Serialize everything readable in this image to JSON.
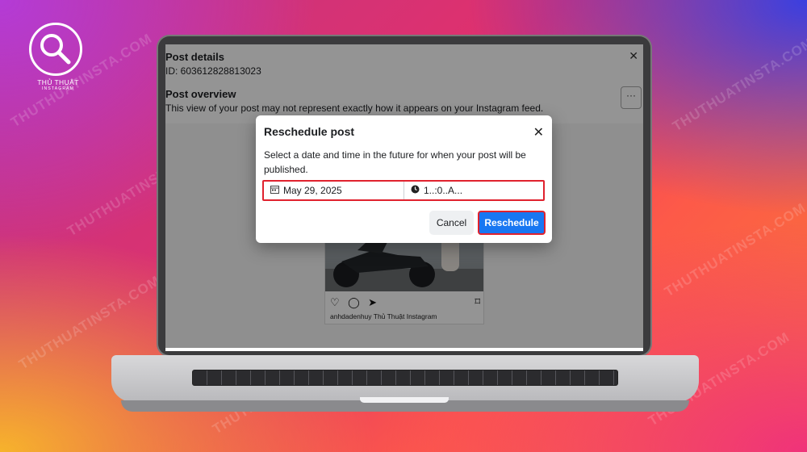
{
  "brand": {
    "name": "THỦ THUẬT",
    "sub": "INSTAGRAM",
    "watermark": "THUTHUATINSTA.COM"
  },
  "post_details": {
    "title": "Post details",
    "id": "ID: 603612828813023",
    "overview_title": "Post overview",
    "overview_desc": "This view of your post may not represent exactly how it appears on your Instagram feed.",
    "more_label": "···",
    "username": "anhdadenhuy",
    "author": "Thủ Thuật Instagram"
  },
  "modal": {
    "title": "Reschedule post",
    "description": "Select a date and time in the future for when your post will be published.",
    "date_value": "May 29, 2025",
    "time_value": "1..:0..A...",
    "cancel_label": "Cancel",
    "reschedule_label": "Reschedule"
  },
  "colors": {
    "accent": "#1877f2",
    "highlight": "#e0222e"
  }
}
